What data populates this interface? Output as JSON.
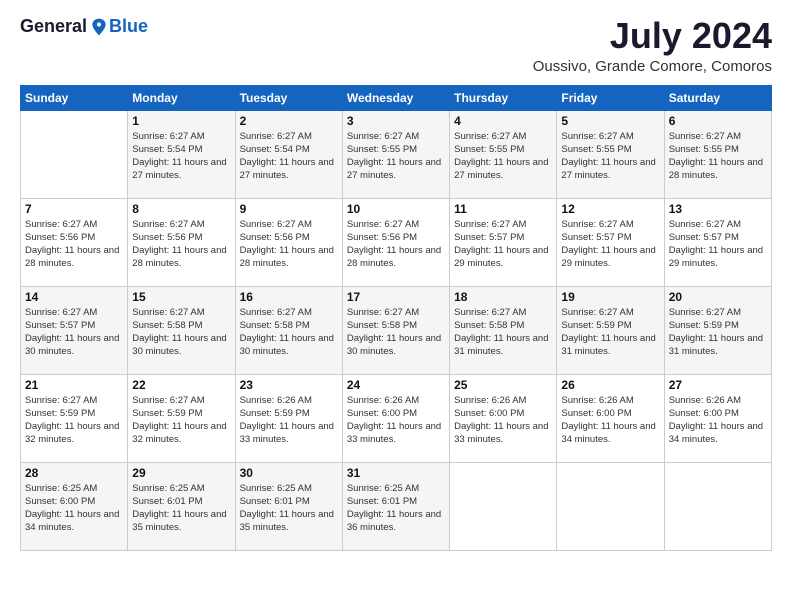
{
  "logo": {
    "general": "General",
    "blue": "Blue"
  },
  "title": {
    "month_year": "July 2024",
    "location": "Oussivo, Grande Comore, Comoros"
  },
  "calendar": {
    "headers": [
      "Sunday",
      "Monday",
      "Tuesday",
      "Wednesday",
      "Thursday",
      "Friday",
      "Saturday"
    ],
    "weeks": [
      [
        {
          "day": "",
          "sunrise": "",
          "sunset": "",
          "daylight": ""
        },
        {
          "day": "1",
          "sunrise": "Sunrise: 6:27 AM",
          "sunset": "Sunset: 5:54 PM",
          "daylight": "Daylight: 11 hours and 27 minutes."
        },
        {
          "day": "2",
          "sunrise": "Sunrise: 6:27 AM",
          "sunset": "Sunset: 5:54 PM",
          "daylight": "Daylight: 11 hours and 27 minutes."
        },
        {
          "day": "3",
          "sunrise": "Sunrise: 6:27 AM",
          "sunset": "Sunset: 5:55 PM",
          "daylight": "Daylight: 11 hours and 27 minutes."
        },
        {
          "day": "4",
          "sunrise": "Sunrise: 6:27 AM",
          "sunset": "Sunset: 5:55 PM",
          "daylight": "Daylight: 11 hours and 27 minutes."
        },
        {
          "day": "5",
          "sunrise": "Sunrise: 6:27 AM",
          "sunset": "Sunset: 5:55 PM",
          "daylight": "Daylight: 11 hours and 27 minutes."
        },
        {
          "day": "6",
          "sunrise": "Sunrise: 6:27 AM",
          "sunset": "Sunset: 5:55 PM",
          "daylight": "Daylight: 11 hours and 28 minutes."
        }
      ],
      [
        {
          "day": "7",
          "sunrise": "Sunrise: 6:27 AM",
          "sunset": "Sunset: 5:56 PM",
          "daylight": "Daylight: 11 hours and 28 minutes."
        },
        {
          "day": "8",
          "sunrise": "Sunrise: 6:27 AM",
          "sunset": "Sunset: 5:56 PM",
          "daylight": "Daylight: 11 hours and 28 minutes."
        },
        {
          "day": "9",
          "sunrise": "Sunrise: 6:27 AM",
          "sunset": "Sunset: 5:56 PM",
          "daylight": "Daylight: 11 hours and 28 minutes."
        },
        {
          "day": "10",
          "sunrise": "Sunrise: 6:27 AM",
          "sunset": "Sunset: 5:56 PM",
          "daylight": "Daylight: 11 hours and 28 minutes."
        },
        {
          "day": "11",
          "sunrise": "Sunrise: 6:27 AM",
          "sunset": "Sunset: 5:57 PM",
          "daylight": "Daylight: 11 hours and 29 minutes."
        },
        {
          "day": "12",
          "sunrise": "Sunrise: 6:27 AM",
          "sunset": "Sunset: 5:57 PM",
          "daylight": "Daylight: 11 hours and 29 minutes."
        },
        {
          "day": "13",
          "sunrise": "Sunrise: 6:27 AM",
          "sunset": "Sunset: 5:57 PM",
          "daylight": "Daylight: 11 hours and 29 minutes."
        }
      ],
      [
        {
          "day": "14",
          "sunrise": "Sunrise: 6:27 AM",
          "sunset": "Sunset: 5:57 PM",
          "daylight": "Daylight: 11 hours and 30 minutes."
        },
        {
          "day": "15",
          "sunrise": "Sunrise: 6:27 AM",
          "sunset": "Sunset: 5:58 PM",
          "daylight": "Daylight: 11 hours and 30 minutes."
        },
        {
          "day": "16",
          "sunrise": "Sunrise: 6:27 AM",
          "sunset": "Sunset: 5:58 PM",
          "daylight": "Daylight: 11 hours and 30 minutes."
        },
        {
          "day": "17",
          "sunrise": "Sunrise: 6:27 AM",
          "sunset": "Sunset: 5:58 PM",
          "daylight": "Daylight: 11 hours and 30 minutes."
        },
        {
          "day": "18",
          "sunrise": "Sunrise: 6:27 AM",
          "sunset": "Sunset: 5:58 PM",
          "daylight": "Daylight: 11 hours and 31 minutes."
        },
        {
          "day": "19",
          "sunrise": "Sunrise: 6:27 AM",
          "sunset": "Sunset: 5:59 PM",
          "daylight": "Daylight: 11 hours and 31 minutes."
        },
        {
          "day": "20",
          "sunrise": "Sunrise: 6:27 AM",
          "sunset": "Sunset: 5:59 PM",
          "daylight": "Daylight: 11 hours and 31 minutes."
        }
      ],
      [
        {
          "day": "21",
          "sunrise": "Sunrise: 6:27 AM",
          "sunset": "Sunset: 5:59 PM",
          "daylight": "Daylight: 11 hours and 32 minutes."
        },
        {
          "day": "22",
          "sunrise": "Sunrise: 6:27 AM",
          "sunset": "Sunset: 5:59 PM",
          "daylight": "Daylight: 11 hours and 32 minutes."
        },
        {
          "day": "23",
          "sunrise": "Sunrise: 6:26 AM",
          "sunset": "Sunset: 5:59 PM",
          "daylight": "Daylight: 11 hours and 33 minutes."
        },
        {
          "day": "24",
          "sunrise": "Sunrise: 6:26 AM",
          "sunset": "Sunset: 6:00 PM",
          "daylight": "Daylight: 11 hours and 33 minutes."
        },
        {
          "day": "25",
          "sunrise": "Sunrise: 6:26 AM",
          "sunset": "Sunset: 6:00 PM",
          "daylight": "Daylight: 11 hours and 33 minutes."
        },
        {
          "day": "26",
          "sunrise": "Sunrise: 6:26 AM",
          "sunset": "Sunset: 6:00 PM",
          "daylight": "Daylight: 11 hours and 34 minutes."
        },
        {
          "day": "27",
          "sunrise": "Sunrise: 6:26 AM",
          "sunset": "Sunset: 6:00 PM",
          "daylight": "Daylight: 11 hours and 34 minutes."
        }
      ],
      [
        {
          "day": "28",
          "sunrise": "Sunrise: 6:25 AM",
          "sunset": "Sunset: 6:00 PM",
          "daylight": "Daylight: 11 hours and 34 minutes."
        },
        {
          "day": "29",
          "sunrise": "Sunrise: 6:25 AM",
          "sunset": "Sunset: 6:01 PM",
          "daylight": "Daylight: 11 hours and 35 minutes."
        },
        {
          "day": "30",
          "sunrise": "Sunrise: 6:25 AM",
          "sunset": "Sunset: 6:01 PM",
          "daylight": "Daylight: 11 hours and 35 minutes."
        },
        {
          "day": "31",
          "sunrise": "Sunrise: 6:25 AM",
          "sunset": "Sunset: 6:01 PM",
          "daylight": "Daylight: 11 hours and 36 minutes."
        },
        {
          "day": "",
          "sunrise": "",
          "sunset": "",
          "daylight": ""
        },
        {
          "day": "",
          "sunrise": "",
          "sunset": "",
          "daylight": ""
        },
        {
          "day": "",
          "sunrise": "",
          "sunset": "",
          "daylight": ""
        }
      ]
    ]
  }
}
